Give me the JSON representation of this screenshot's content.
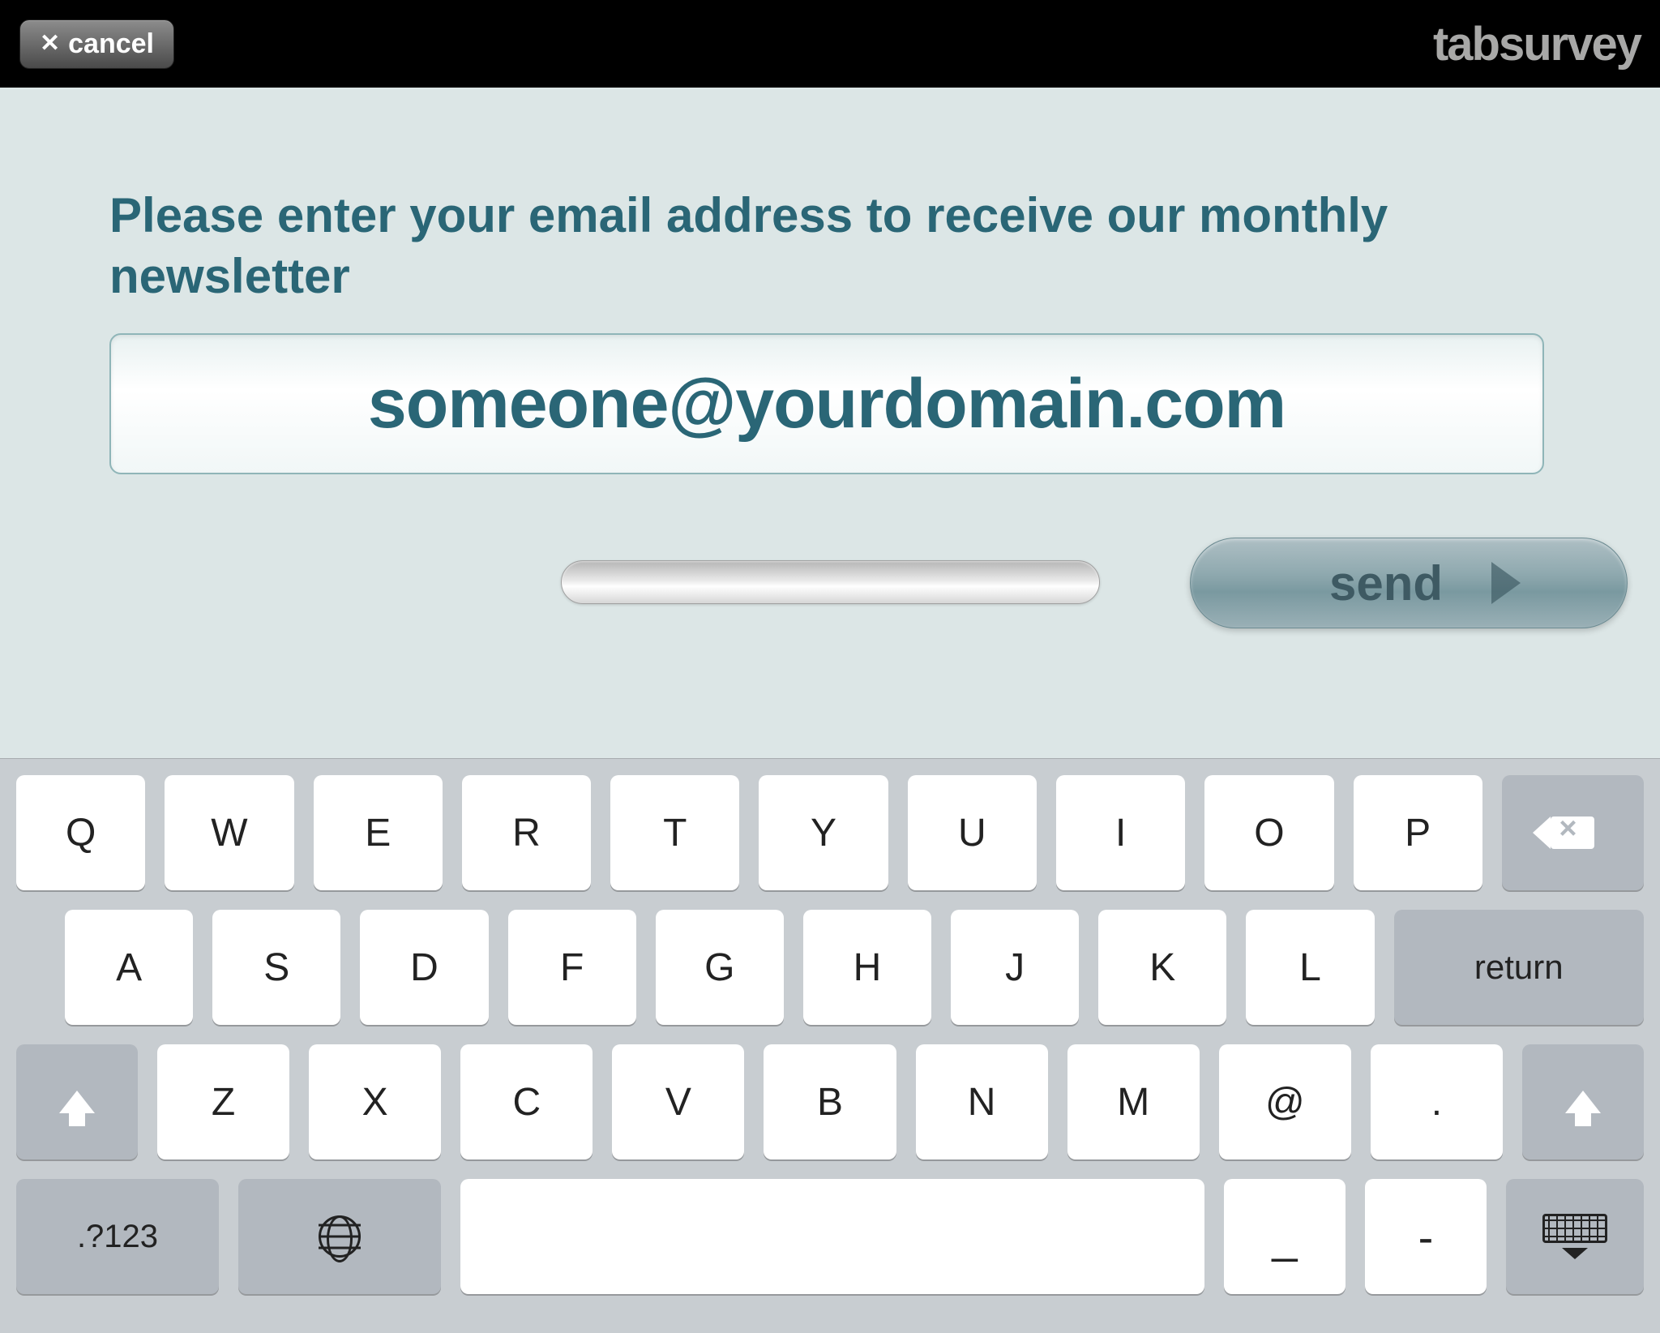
{
  "topbar": {
    "cancel_label": "cancel",
    "brand": "tabsurvey"
  },
  "main": {
    "prompt": "Please enter your email address to receive our monthly newsletter",
    "email_value": "someone@yourdomain.com",
    "email_placeholder": "someone@yourdomain.com",
    "send_label": "send"
  },
  "keyboard": {
    "row1": [
      "Q",
      "W",
      "E",
      "R",
      "T",
      "Y",
      "U",
      "I",
      "O",
      "P"
    ],
    "row2": [
      "A",
      "S",
      "D",
      "F",
      "G",
      "H",
      "J",
      "K",
      "L"
    ],
    "return_label": "return",
    "row3": [
      "Z",
      "X",
      "C",
      "V",
      "B",
      "N",
      "M",
      "@",
      "."
    ],
    "num_label": ".?123",
    "underscore": "_",
    "hyphen": "-"
  }
}
